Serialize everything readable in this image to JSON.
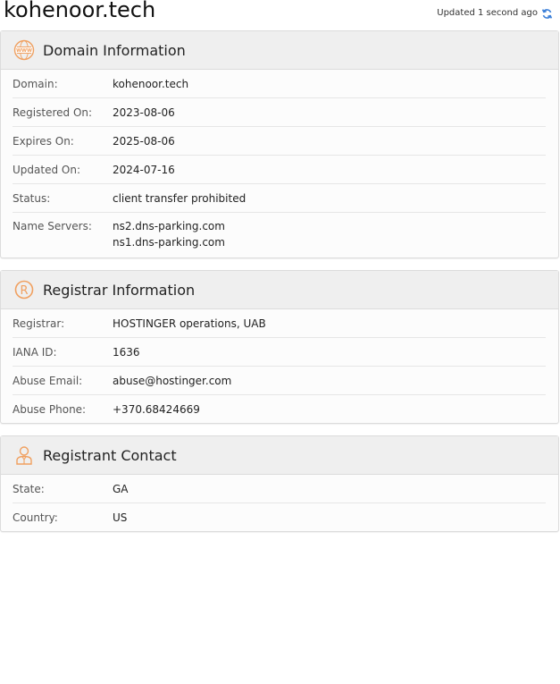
{
  "header": {
    "domain": "kohenoor.tech",
    "updated_text": "Updated 1 second ago"
  },
  "colors": {
    "accent": "#f0a060",
    "refresh": "#3b7fd8"
  },
  "sections": {
    "domain_info": {
      "title": "Domain Information",
      "icon": "www-icon",
      "rows": [
        {
          "label": "Domain:",
          "value": "kohenoor.tech"
        },
        {
          "label": "Registered On:",
          "value": "2023-08-06"
        },
        {
          "label": "Expires On:",
          "value": "2025-08-06"
        },
        {
          "label": "Updated On:",
          "value": "2024-07-16"
        },
        {
          "label": "Status:",
          "value": "client transfer prohibited"
        },
        {
          "label": "Name Servers:",
          "values": [
            "ns2.dns-parking.com",
            "ns1.dns-parking.com"
          ]
        }
      ]
    },
    "registrar_info": {
      "title": "Registrar Information",
      "icon": "registered-icon",
      "rows": [
        {
          "label": "Registrar:",
          "value": "HOSTINGER operations, UAB"
        },
        {
          "label": "IANA ID:",
          "value": "1636"
        },
        {
          "label": "Abuse Email:",
          "value": "abuse@hostinger.com"
        },
        {
          "label": "Abuse Phone:",
          "value": "+370.68424669"
        }
      ]
    },
    "registrant_contact": {
      "title": "Registrant Contact",
      "icon": "person-icon",
      "rows": [
        {
          "label": "State:",
          "value": "GA"
        },
        {
          "label": "Country:",
          "value": "US"
        }
      ]
    }
  }
}
